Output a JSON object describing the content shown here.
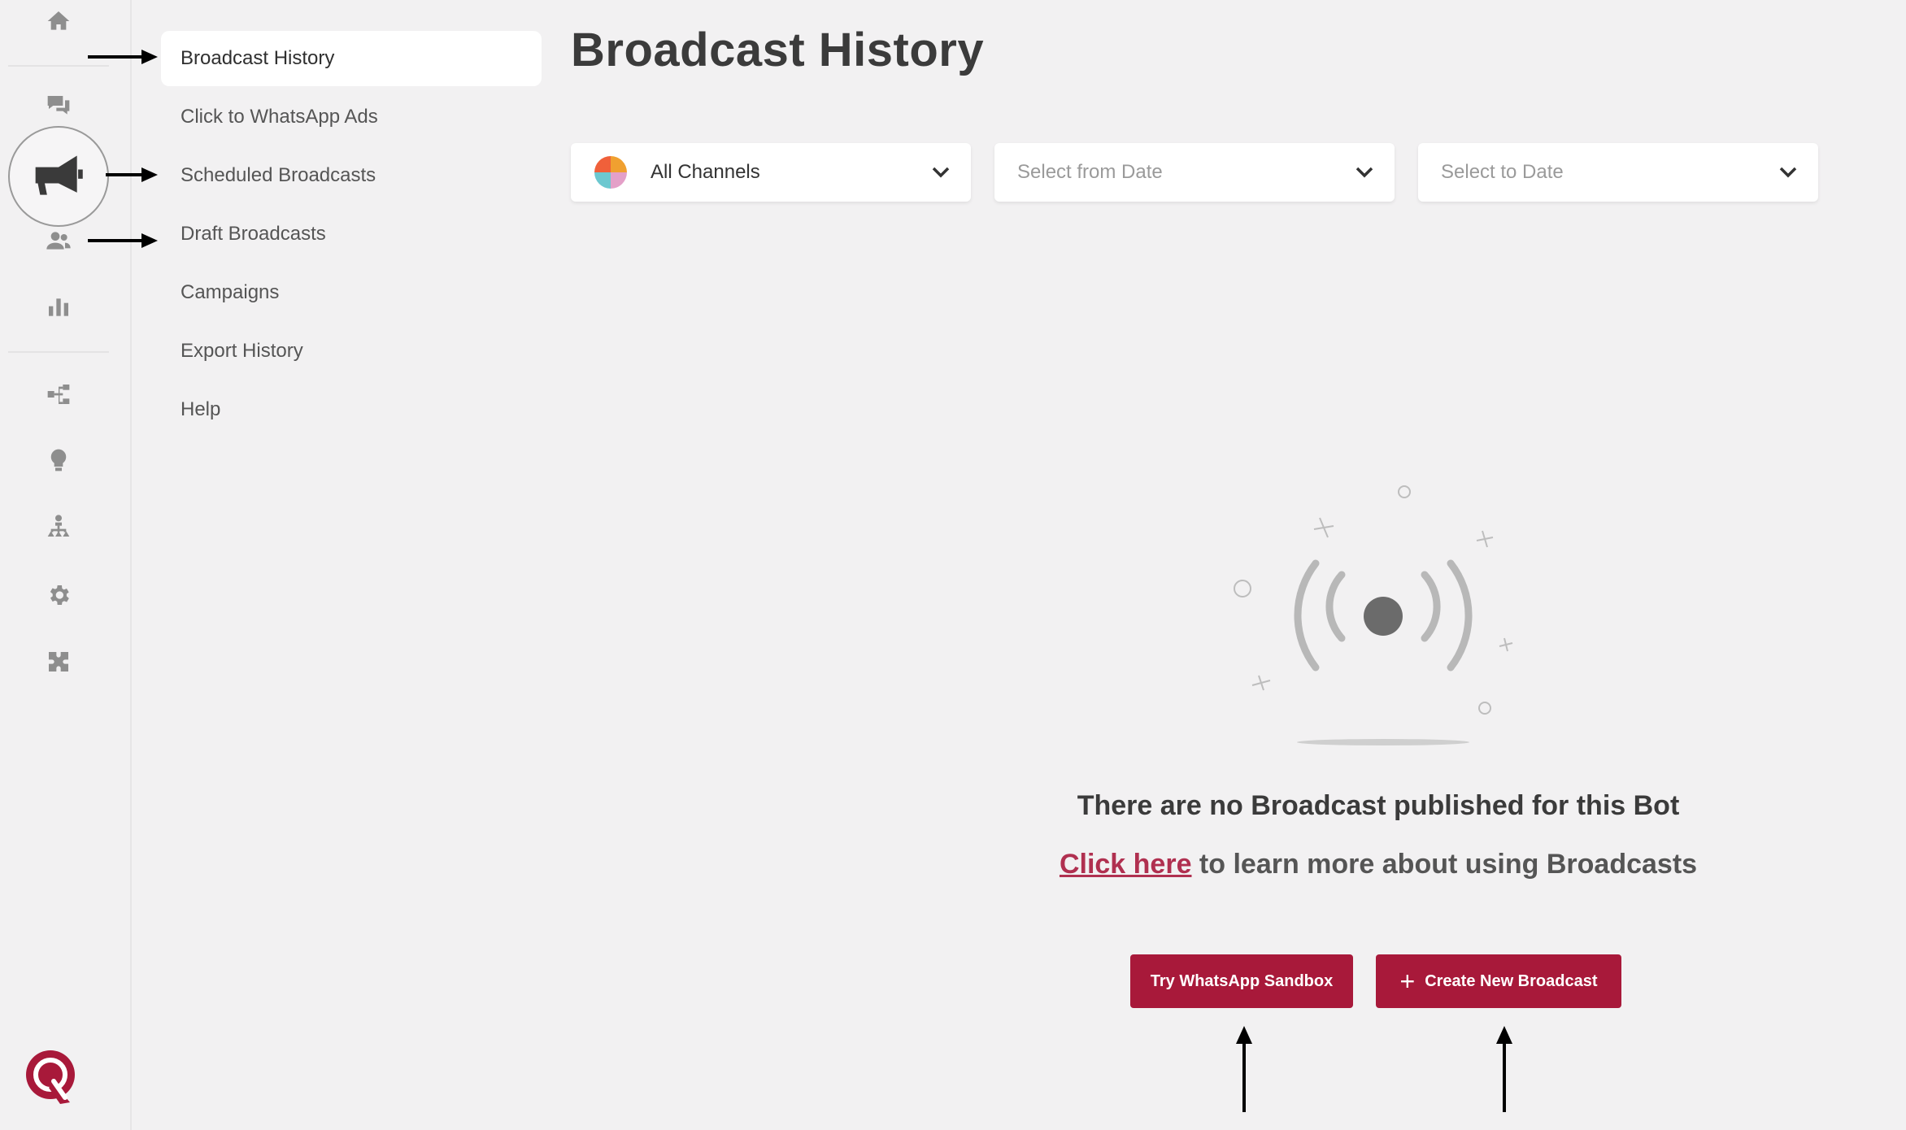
{
  "colors": {
    "accent": "#a8193a",
    "link": "#b03050",
    "background": "#f2f1f2"
  },
  "rail": {
    "icons": [
      "home-icon",
      "chat-icon",
      "megaphone-icon",
      "users-icon",
      "bar-chart-icon",
      "flow-icon",
      "lightbulb-icon",
      "hierarchy-icon",
      "gear-icon",
      "puzzle-icon"
    ],
    "active": "megaphone-icon",
    "logo": "brand-logo-icon"
  },
  "submenu": {
    "items": [
      {
        "label": "Broadcast History",
        "active": true
      },
      {
        "label": "Click to WhatsApp Ads"
      },
      {
        "label": "Scheduled Broadcasts"
      },
      {
        "label": "Draft Broadcasts"
      },
      {
        "label": "Campaigns"
      },
      {
        "label": "Export History"
      },
      {
        "label": "Help"
      }
    ]
  },
  "main": {
    "title": "Broadcast History",
    "filters": {
      "channel": "All Channels",
      "from_date_placeholder": "Select from Date",
      "to_date_placeholder": "Select to Date"
    },
    "empty_state": {
      "title": "There are no Broadcast published for this Bot",
      "link_text": "Click here",
      "subtitle_rest": " to learn more about using Broadcasts"
    },
    "buttons": {
      "sandbox": "Try WhatsApp Sandbox",
      "create": "Create New Broadcast"
    }
  }
}
